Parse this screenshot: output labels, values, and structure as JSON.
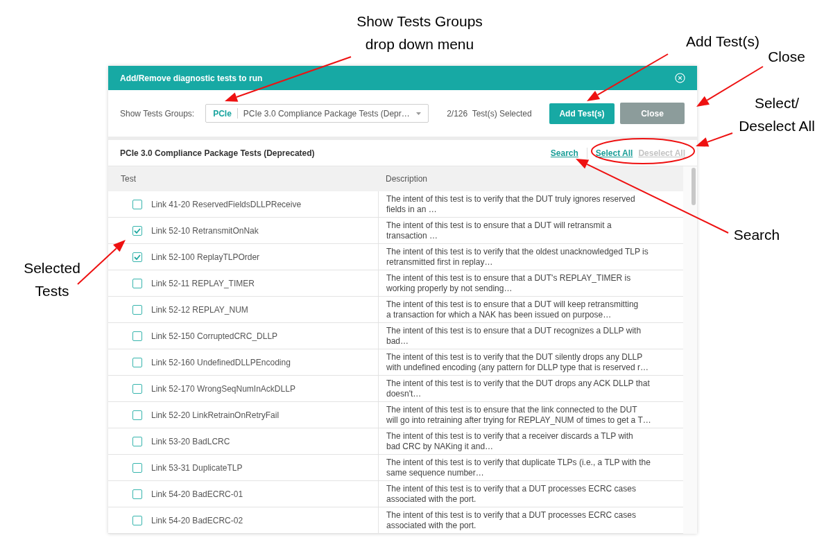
{
  "annotations": [
    {
      "lines": [
        "Show Tests Groups",
        "drop down menu"
      ]
    },
    {
      "lines": [
        "Add Test(s)"
      ]
    },
    {
      "lines": [
        "Close"
      ]
    },
    {
      "lines": [
        "Select/",
        "Deselect All"
      ]
    },
    {
      "lines": [
        "Search"
      ]
    },
    {
      "lines": [
        "Selected",
        "Tests"
      ]
    }
  ],
  "dialog": {
    "title": "Add/Remove diagnostic tests to run",
    "toolbar": {
      "label": "Show Tests Groups:",
      "group_select": {
        "tag": "PCIe",
        "value": "PCIe 3.0 Compliance Package Tests (Depr…"
      },
      "selected_count": "2/126  Test(s) Selected",
      "buttons": [
        {
          "label": "Add Test(s)",
          "kind": "primary"
        },
        {
          "label": "Close",
          "kind": "secondary"
        }
      ]
    },
    "section": {
      "title": "PCIe 3.0 Compliance Package Tests (Deprecated)",
      "links": [
        {
          "label": "Search",
          "disabled": false
        },
        {
          "label": "Select All",
          "disabled": false
        },
        {
          "label": "Deselect All",
          "disabled": true
        }
      ]
    },
    "table": {
      "columns": [
        "Test",
        "Description"
      ],
      "rows": [
        {
          "test": "Link 41-20 ReservedFieldsDLLPReceive",
          "description": "The intent of this test is to verify that the DUT truly ignores reserved\nfields in an …",
          "checked": false
        },
        {
          "test": "Link 52-10 RetransmitOnNak",
          "description": "The intent of this test is to ensure that a DUT will retransmit a\ntransaction …",
          "checked": true
        },
        {
          "test": "Link 52-100 ReplayTLPOrder",
          "description": "The intent of this test is to verify that the oldest unacknowledged TLP is\nretransmitted first in replay…",
          "checked": true
        },
        {
          "test": "Link 52-11 REPLAY_TIMER",
          "description": "The intent of this test is to ensure that a DUT's REPLAY_TIMER is\nworking properly by not sending…",
          "checked": false
        },
        {
          "test": "Link 52-12 REPLAY_NUM",
          "description": "The intent of this test is to ensure that a DUT will keep retransmitting\na transaction for which a NAK has been issued on purpose…",
          "checked": false
        },
        {
          "test": "Link 52-150 CorruptedCRC_DLLP",
          "description": "The intent of this test is to ensure that a DUT recognizes a DLLP with\nbad…",
          "checked": false
        },
        {
          "test": "Link 52-160 UndefinedDLLPEncoding",
          "description": "The intent of this test is to verify that the DUT silently drops any DLLP\nwith undefined encoding (any pattern for DLLP type that is reserved r…",
          "checked": false
        },
        {
          "test": "Link 52-170 WrongSeqNumInAckDLLP",
          "description": "The intent of this test is to verify that the DUT drops any ACK DLLP that\ndoesn't…",
          "checked": false
        },
        {
          "test": "Link 52-20 LinkRetrainOnRetryFail",
          "description": "The intent of this test is to ensure that the link connected to the DUT\nwill go into retraining after trying for REPLAY_NUM of times to get a T…",
          "checked": false
        },
        {
          "test": "Link 53-20 BadLCRC",
          "description": "The intent of this test is to verify that a receiver discards a TLP with\nbad CRC by NAKing it and…",
          "checked": false
        },
        {
          "test": "Link 53-31 DuplicateTLP",
          "description": "The intent of this test is to verify that duplicate TLPs (i.e., a TLP with the\nsame sequence number…",
          "checked": false
        },
        {
          "test": "Link 54-20 BadECRC-01",
          "description": "The intent of this test is to verify that a DUT processes ECRC cases\nassociated with the port.",
          "checked": false
        },
        {
          "test": "Link 54-20 BadECRC-02",
          "description": "The intent of this test is to verify that a DUT processes ECRC cases\nassociated with the port.",
          "checked": false
        }
      ]
    }
  }
}
